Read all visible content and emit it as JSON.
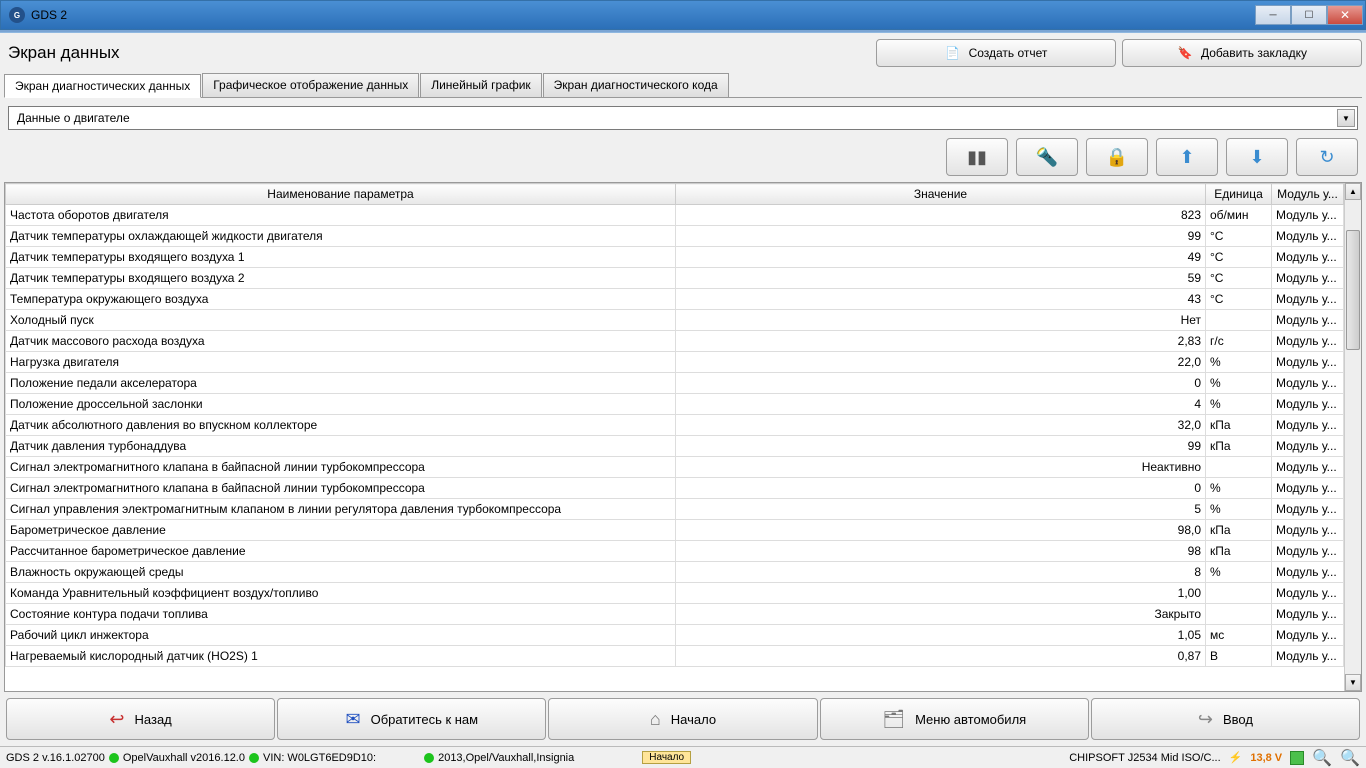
{
  "window": {
    "title": "GDS 2"
  },
  "page": {
    "title": "Экран данных"
  },
  "header_buttons": {
    "report": "Создать отчет",
    "bookmark": "Добавить закладку"
  },
  "tabs": [
    "Экран диагностических данных",
    "Графическое отображение данных",
    "Линейный график",
    "Экран диагностического кода"
  ],
  "dropdown": {
    "value": "Данные о двигателе"
  },
  "table": {
    "headers": {
      "param": "Наименование параметра",
      "value": "Значение",
      "unit": "Единица",
      "module": "Модуль у..."
    },
    "rows": [
      {
        "param": "Частота оборотов двигателя",
        "value": "823",
        "unit": "об/мин",
        "module": "Модуль у..."
      },
      {
        "param": "Датчик температуры охлаждающей жидкости двигателя",
        "value": "99",
        "unit": "°С",
        "module": "Модуль у..."
      },
      {
        "param": "Датчик температуры входящего воздуха 1",
        "value": "49",
        "unit": "°С",
        "module": "Модуль у..."
      },
      {
        "param": "Датчик температуры входящего воздуха 2",
        "value": "59",
        "unit": "°С",
        "module": "Модуль у..."
      },
      {
        "param": "Температура окружающего воздуха",
        "value": "43",
        "unit": "°С",
        "module": "Модуль у..."
      },
      {
        "param": "Холодный пуск",
        "value": "Нет",
        "unit": "",
        "module": "Модуль у..."
      },
      {
        "param": "Датчик массового расхода воздуха",
        "value": "2,83",
        "unit": "г/с",
        "module": "Модуль у..."
      },
      {
        "param": "Нагрузка двигателя",
        "value": "22,0",
        "unit": "%",
        "module": "Модуль у..."
      },
      {
        "param": "Положение педали акселератора",
        "value": "0",
        "unit": "%",
        "module": "Модуль у..."
      },
      {
        "param": "Положение дроссельной заслонки",
        "value": "4",
        "unit": "%",
        "module": "Модуль у..."
      },
      {
        "param": "Датчик абсолютного давления во впускном коллекторе",
        "value": "32,0",
        "unit": "кПа",
        "module": "Модуль у..."
      },
      {
        "param": "Датчик давления турбонаддува",
        "value": "99",
        "unit": "кПа",
        "module": "Модуль у..."
      },
      {
        "param": "Сигнал электромагнитного клапана в байпасной линии турбокомпрессора",
        "value": "Неактивно",
        "unit": "",
        "module": "Модуль у..."
      },
      {
        "param": "Сигнал электромагнитного клапана в байпасной линии турбокомпрессора",
        "value": "0",
        "unit": "%",
        "module": "Модуль у..."
      },
      {
        "param": "Сигнал управления электромагнитным клапаном в линии регулятора давления турбокомпрессора",
        "value": "5",
        "unit": "%",
        "module": "Модуль у..."
      },
      {
        "param": "Барометрическое давление",
        "value": "98,0",
        "unit": "кПа",
        "module": "Модуль у..."
      },
      {
        "param": "Рассчитанное барометрическое давление",
        "value": "98",
        "unit": "кПа",
        "module": "Модуль у..."
      },
      {
        "param": "Влажность окружающей среды",
        "value": "8",
        "unit": "%",
        "module": "Модуль у..."
      },
      {
        "param": "Команда Уравнительный коэффициент воздух/топливо",
        "value": "1,00",
        "unit": "",
        "module": "Модуль у..."
      },
      {
        "param": "Состояние контура подачи топлива",
        "value": "Закрыто",
        "unit": "",
        "module": "Модуль у..."
      },
      {
        "param": "Рабочий цикл инжектора",
        "value": "1,05",
        "unit": "мс",
        "module": "Модуль у..."
      },
      {
        "param": "Нагреваемый кислородный датчик (HO2S) 1",
        "value": "0,87",
        "unit": "В",
        "module": "Модуль у..."
      }
    ]
  },
  "bottom": {
    "back": "Назад",
    "contact": "Обратитесь к нам",
    "home": "Начало",
    "car_menu": "Меню автомобиля",
    "enter": "Ввод"
  },
  "status": {
    "version": "GDS 2 v.16.1.02700",
    "profile": "OpelVauxhall v2016.12.0",
    "vin_label": "VIN: W0LGT6ED9D10:",
    "vehicle": "2013,Opel/Vauxhall,Insignia",
    "chip": "Начало",
    "interface": "CHIPSOFT J2534 Mid ISO/C...",
    "voltage": "13,8 V"
  }
}
